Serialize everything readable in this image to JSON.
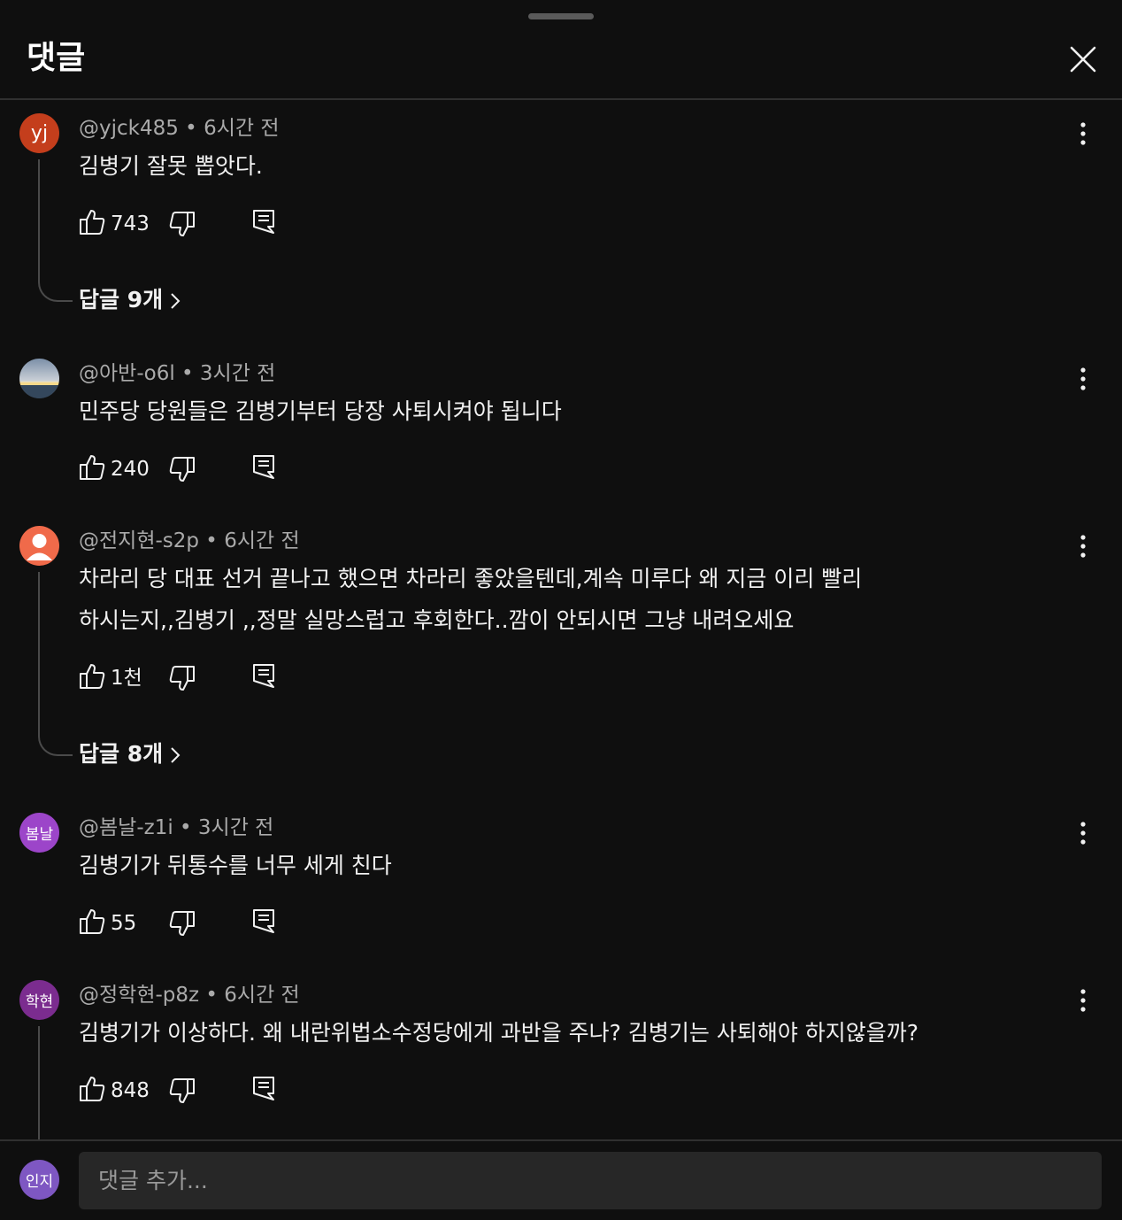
{
  "header": {
    "title": "댓글"
  },
  "colors": {
    "background": "#0f0f0f",
    "avatar_yjck": "#c43e1c",
    "avatar_jeonjihyeon": "#f06a4a",
    "avatar_bomnal": "#9c45c9",
    "avatar_jeonghakhyeon": "#7b2c8f",
    "avatar_inji": "#7e57c2"
  },
  "comments": [
    {
      "avatar_text": "yj",
      "author": "@yjck485",
      "time": "6시간 전",
      "lines": [
        "김병기 잘못 뽑앗다."
      ],
      "likes": "743",
      "replies": "답글 9개"
    },
    {
      "avatar_text": "",
      "avatar_icon": "sunset-photo",
      "author": "@아반-o6l",
      "time": "3시간 전",
      "lines": [
        "민주당 당원들은 김병기부터 당장 사퇴시켜야 됩니다"
      ],
      "likes": "240"
    },
    {
      "avatar_text": "",
      "avatar_icon": "default-person-icon",
      "author": "@전지현-s2p",
      "time": "6시간 전",
      "lines": [
        "차라리 당 대표 선거 끝나고 했으면 차라리 좋았을텐데,계속 미루다 왜 지금 이리 빨리",
        "하시는지,,김병기 ,,정말  실망스럽고 후회한다..깜이 안되시면 그냥 내려오세요"
      ],
      "likes": "1천",
      "replies": "답글 8개"
    },
    {
      "avatar_text": "봄날",
      "author": "@봄날-z1i",
      "time": "3시간 전",
      "lines": [
        "김병기가 뒤통수를 너무 세게 친다"
      ],
      "likes": "55"
    },
    {
      "avatar_text": "학현",
      "author": "@정학현-p8z",
      "time": "6시간 전",
      "lines": [
        "김병기가 이상하다. 왜 내란위법소수정당에게 과반을 주나? 김병기는 사퇴해야 하지않을까?"
      ],
      "likes": "848"
    }
  ],
  "composer": {
    "avatar_text": "인지",
    "placeholder": "댓글 추가..."
  }
}
